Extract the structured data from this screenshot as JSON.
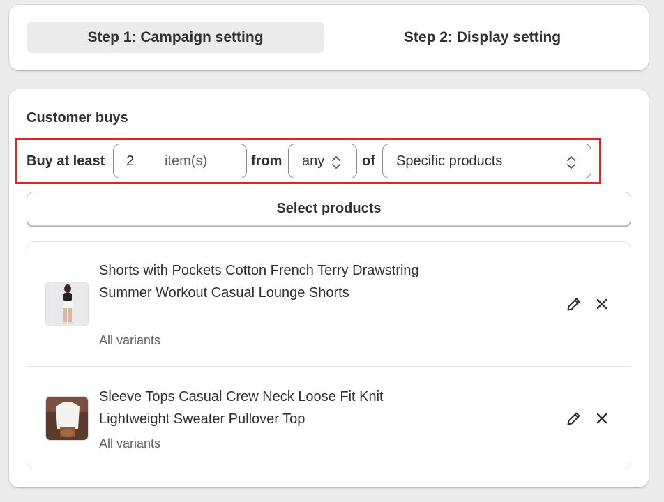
{
  "steps": {
    "step1_label": "Step 1: Campaign setting",
    "step2_label": "Step 2: Display setting"
  },
  "customer_buys": {
    "title": "Customer buys",
    "buy_at_least_label": "Buy at least",
    "quantity_value": "2",
    "quantity_suffix": "item(s)",
    "from_label": "from",
    "scope_value": "any",
    "of_label": "of",
    "product_type_value": "Specific products"
  },
  "select_products_label": "Select products",
  "products": [
    {
      "title": "Shorts with Pockets Cotton French Terry Drawstring Summer Workout Casual Lounge Shorts",
      "variants": "All variants"
    },
    {
      "title": "Sleeve Tops Casual Crew Neck Loose Fit Knit Lightweight Sweater Pullover Top",
      "variants": "All variants"
    }
  ],
  "colors": {
    "page_bg": "#ebebeb",
    "highlight_border": "#e02424",
    "text_primary": "#303030",
    "text_secondary": "#616161"
  },
  "icons": {
    "edit": "pencil-icon",
    "remove": "close-icon",
    "select": "chevron-up-down-icon"
  }
}
